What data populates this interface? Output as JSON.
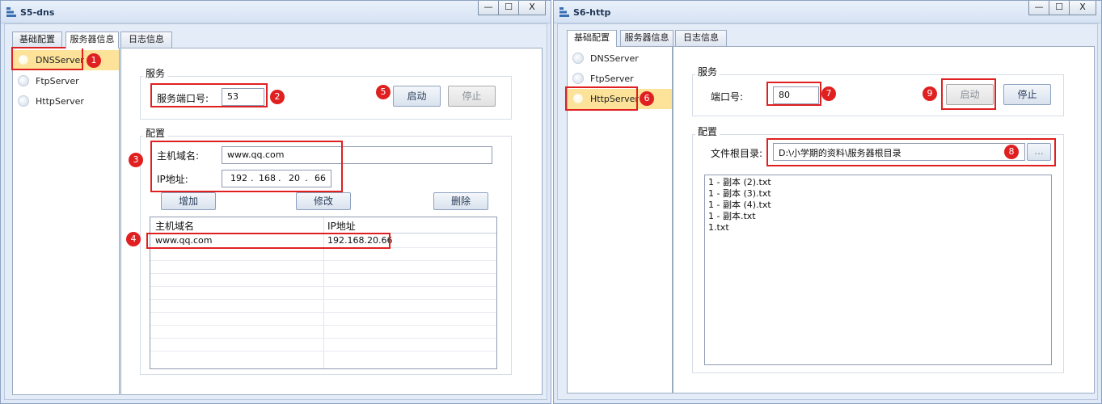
{
  "dns_window": {
    "title": "S5-dns",
    "controls": {
      "minimize": "—",
      "maximize": "☐",
      "close": "X"
    },
    "tabs": [
      "基础配置",
      "服务器信息",
      "日志信息"
    ],
    "servers": [
      {
        "label": "DNSServer",
        "selected": true
      },
      {
        "label": "FtpServer",
        "selected": false
      },
      {
        "label": "HttpServer",
        "selected": false
      }
    ],
    "service_group": {
      "legend": "服务",
      "port_label": "服务端口号:",
      "port_value": "53",
      "start_label": "启动",
      "stop_label": "停止"
    },
    "config_group": {
      "legend": "配置",
      "host_label": "主机域名:",
      "host_value": "www.qq.com",
      "ip_label": "IP地址:",
      "ip_octets": [
        "192",
        "168",
        "20",
        "66"
      ],
      "ip_dot": ".",
      "add_label": "增加",
      "modify_label": "修改",
      "delete_label": "删除",
      "table_headers": [
        "主机域名",
        "IP地址"
      ],
      "rows": [
        {
          "host": "www.qq.com",
          "ip": "192.168.20.66"
        }
      ]
    },
    "markers": [
      "1",
      "2",
      "3",
      "4",
      "5"
    ]
  },
  "http_window": {
    "title": "S6-http",
    "controls": {
      "minimize": "—",
      "maximize": "☐",
      "close": "X"
    },
    "tabs": [
      "基础配置",
      "服务器信息",
      "日志信息"
    ],
    "servers": [
      {
        "label": "DNSServer",
        "selected": false
      },
      {
        "label": "FtpServer",
        "selected": false
      },
      {
        "label": "HttpServer",
        "selected": true
      }
    ],
    "service_group": {
      "legend": "服务",
      "port_label": "端口号:",
      "port_value": "80",
      "start_label": "启动",
      "stop_label": "停止"
    },
    "config_group": {
      "legend": "配置",
      "root_label": "文件根目录:",
      "root_value": "D:\\小学期的资料\\服务器根目录",
      "browse_label": "...",
      "files": [
        "1 - 副本 (2).txt",
        "1 - 副本 (3).txt",
        "1 - 副本 (4).txt",
        "1 - 副本.txt",
        "1.txt"
      ]
    },
    "markers": [
      "6",
      "7",
      "8",
      "9"
    ]
  },
  "colors": {
    "annotation_red": "#e02020",
    "selected_item": "#fde39a",
    "window_bg": "#dfe8f6"
  }
}
